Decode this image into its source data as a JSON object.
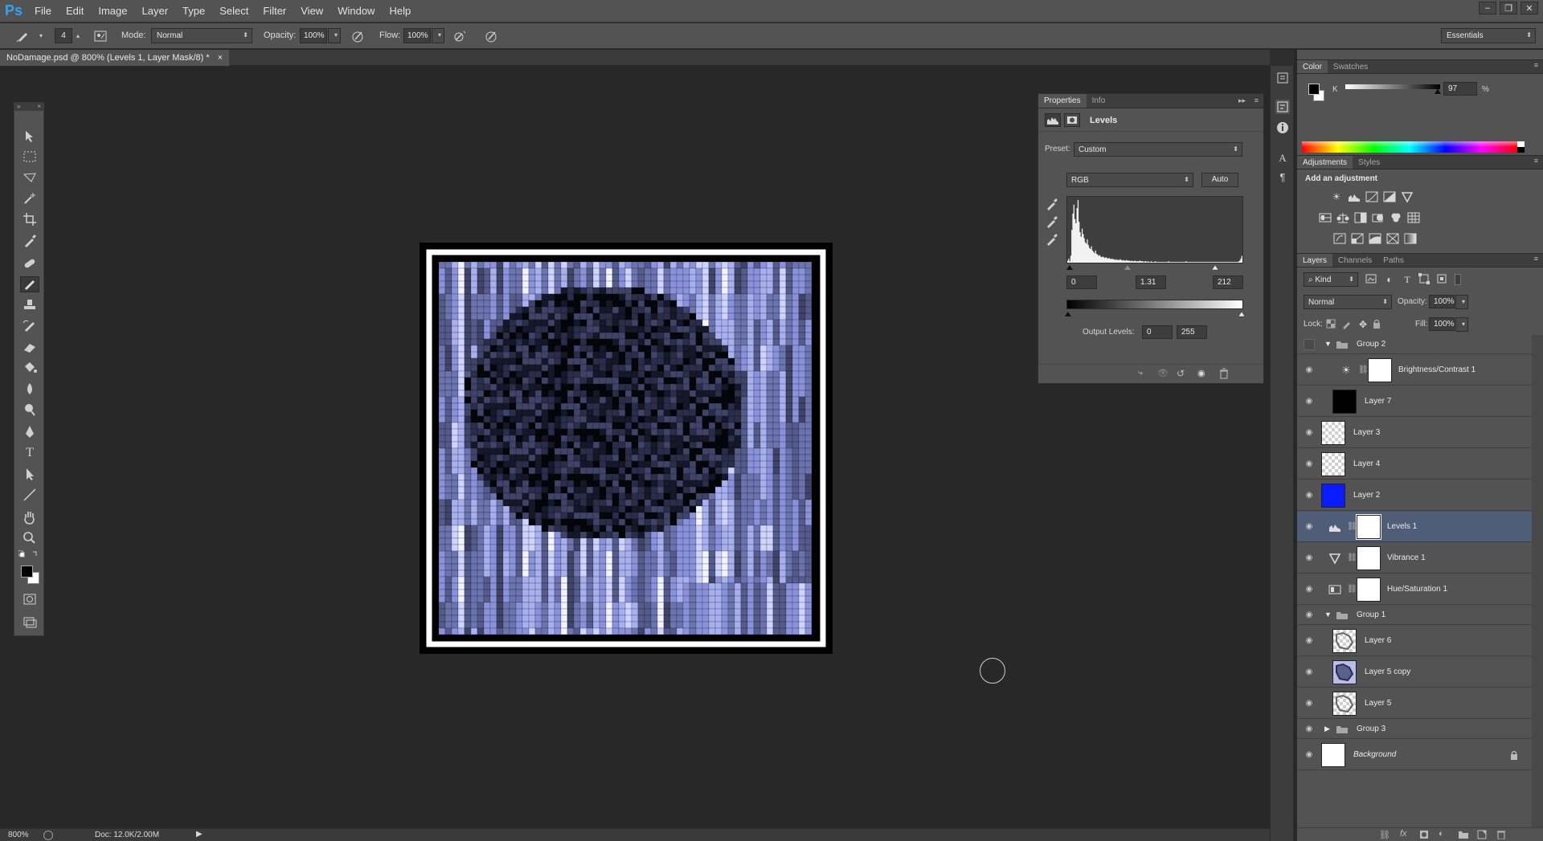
{
  "app": {
    "logo": "Ps"
  },
  "menu": [
    "File",
    "Edit",
    "Image",
    "Layer",
    "Type",
    "Select",
    "Filter",
    "View",
    "Window",
    "Help"
  ],
  "window_controls": [
    "–",
    "❐",
    "✕"
  ],
  "options": {
    "brush_size": "4",
    "mode_label": "Mode:",
    "mode_value": "Normal",
    "opacity_label": "Opacity:",
    "opacity_value": "100%",
    "flow_label": "Flow:",
    "flow_value": "100%",
    "workspace": "Essentials"
  },
  "document": {
    "tab_title": "NoDamage.psd @ 800% (Levels 1, Layer Mask/8) *",
    "close": "×"
  },
  "tools_header": {
    "collapse": "»",
    "close": "×"
  },
  "properties": {
    "tabs": [
      "Properties",
      "Info"
    ],
    "title": "Levels",
    "preset_label": "Preset:",
    "preset_value": "Custom",
    "channel": "RGB",
    "auto_label": "Auto",
    "input_black": "0",
    "input_gamma": "1.31",
    "input_white": "212",
    "output_label": "Output Levels:",
    "output_black": "0",
    "output_white": "255",
    "histogram": [
      3,
      6,
      2,
      10,
      48,
      72,
      85,
      64,
      58,
      80,
      92,
      60,
      45,
      38,
      50,
      42,
      36,
      30,
      28,
      34,
      26,
      22,
      20,
      24,
      18,
      16,
      14,
      18,
      13,
      12,
      10,
      11,
      9,
      8,
      9,
      8,
      7,
      8,
      7,
      6,
      7,
      6,
      5,
      6,
      5,
      5,
      4,
      5,
      4,
      4,
      4,
      5,
      4,
      3,
      4,
      3,
      3,
      4,
      3,
      3,
      3,
      2,
      3,
      2,
      2,
      3,
      2,
      2,
      2,
      2,
      3,
      2,
      2,
      2,
      1,
      2,
      2,
      1,
      2,
      1,
      1,
      2,
      1,
      1,
      1,
      2,
      1,
      1,
      1,
      1,
      1,
      1,
      1,
      1,
      1,
      1,
      1,
      1,
      2,
      1,
      1,
      1,
      1,
      1,
      1,
      1,
      1,
      1,
      1,
      1,
      1,
      1,
      1,
      1,
      1,
      2,
      1,
      1,
      1,
      1,
      1,
      1,
      1,
      1,
      1,
      1,
      1,
      1,
      1,
      1,
      1,
      1,
      1,
      1,
      1,
      1,
      1,
      1,
      1,
      1,
      1,
      1,
      1,
      1,
      1,
      1,
      1,
      1,
      1,
      1,
      1,
      1,
      1,
      1,
      1,
      1,
      1,
      1,
      1,
      1,
      1,
      1,
      1,
      1,
      1,
      1,
      2,
      3,
      6,
      10
    ]
  },
  "color_panel": {
    "tabs": [
      "Color",
      "Swatches"
    ],
    "channel": "K",
    "k_value": "97",
    "unit": "%"
  },
  "adjustments_panel": {
    "tabs": [
      "Adjustments",
      "Styles"
    ],
    "title": "Add an adjustment"
  },
  "layers_panel": {
    "tabs": [
      "Layers",
      "Channels",
      "Paths"
    ],
    "filter_kind": "Kind",
    "blend_mode": "Normal",
    "opacity_label": "Opacity:",
    "opacity_value": "100%",
    "lock_label": "Lock:",
    "fill_label": "Fill:",
    "fill_value": "100%",
    "layers": [
      {
        "name": "Group 2",
        "kind": "group",
        "expanded": true,
        "visible": false
      },
      {
        "name": "Brightness/Contrast 1",
        "kind": "adjustment",
        "icon": "sun-icon",
        "visible": true,
        "indent": true
      },
      {
        "name": "Layer 7",
        "kind": "pixel",
        "thumb": "black",
        "visible": true,
        "indent": true
      },
      {
        "name": "Layer 3",
        "kind": "pixel",
        "thumb": "checker",
        "visible": true
      },
      {
        "name": "Layer 4",
        "kind": "pixel",
        "thumb": "checker",
        "visible": true
      },
      {
        "name": "Layer 2",
        "kind": "pixel",
        "thumb": "blue",
        "visible": true
      },
      {
        "name": "Levels 1",
        "kind": "adjustment",
        "icon": "levels-icon",
        "visible": true,
        "selected": true
      },
      {
        "name": "Vibrance 1",
        "kind": "adjustment",
        "icon": "vibrance-icon",
        "visible": true
      },
      {
        "name": "Hue/Saturation 1",
        "kind": "adjustment",
        "icon": "hue-saturation-icon",
        "visible": true
      },
      {
        "name": "Group 1",
        "kind": "group",
        "expanded": true,
        "visible": true
      },
      {
        "name": "Layer 6",
        "kind": "pixel",
        "thumb": "pattern",
        "visible": true,
        "indent": true
      },
      {
        "name": "Layer 5 copy",
        "kind": "pixel",
        "thumb": "pattern-blue",
        "visible": true,
        "indent": true
      },
      {
        "name": "Layer 5",
        "kind": "pixel",
        "thumb": "pattern",
        "visible": true,
        "indent": true
      },
      {
        "name": "Group 3",
        "kind": "group",
        "expanded": false,
        "visible": true
      },
      {
        "name": "Background",
        "kind": "background",
        "thumb": "white",
        "visible": true,
        "locked": true
      }
    ]
  },
  "status": {
    "zoom": "800%",
    "doc": "Doc: 12.0K/2.00M"
  },
  "colors": {
    "accent_selected": "#4f5d78",
    "layer2_blue": "#0a1cff",
    "canvas_tint": "#8c92e6"
  }
}
